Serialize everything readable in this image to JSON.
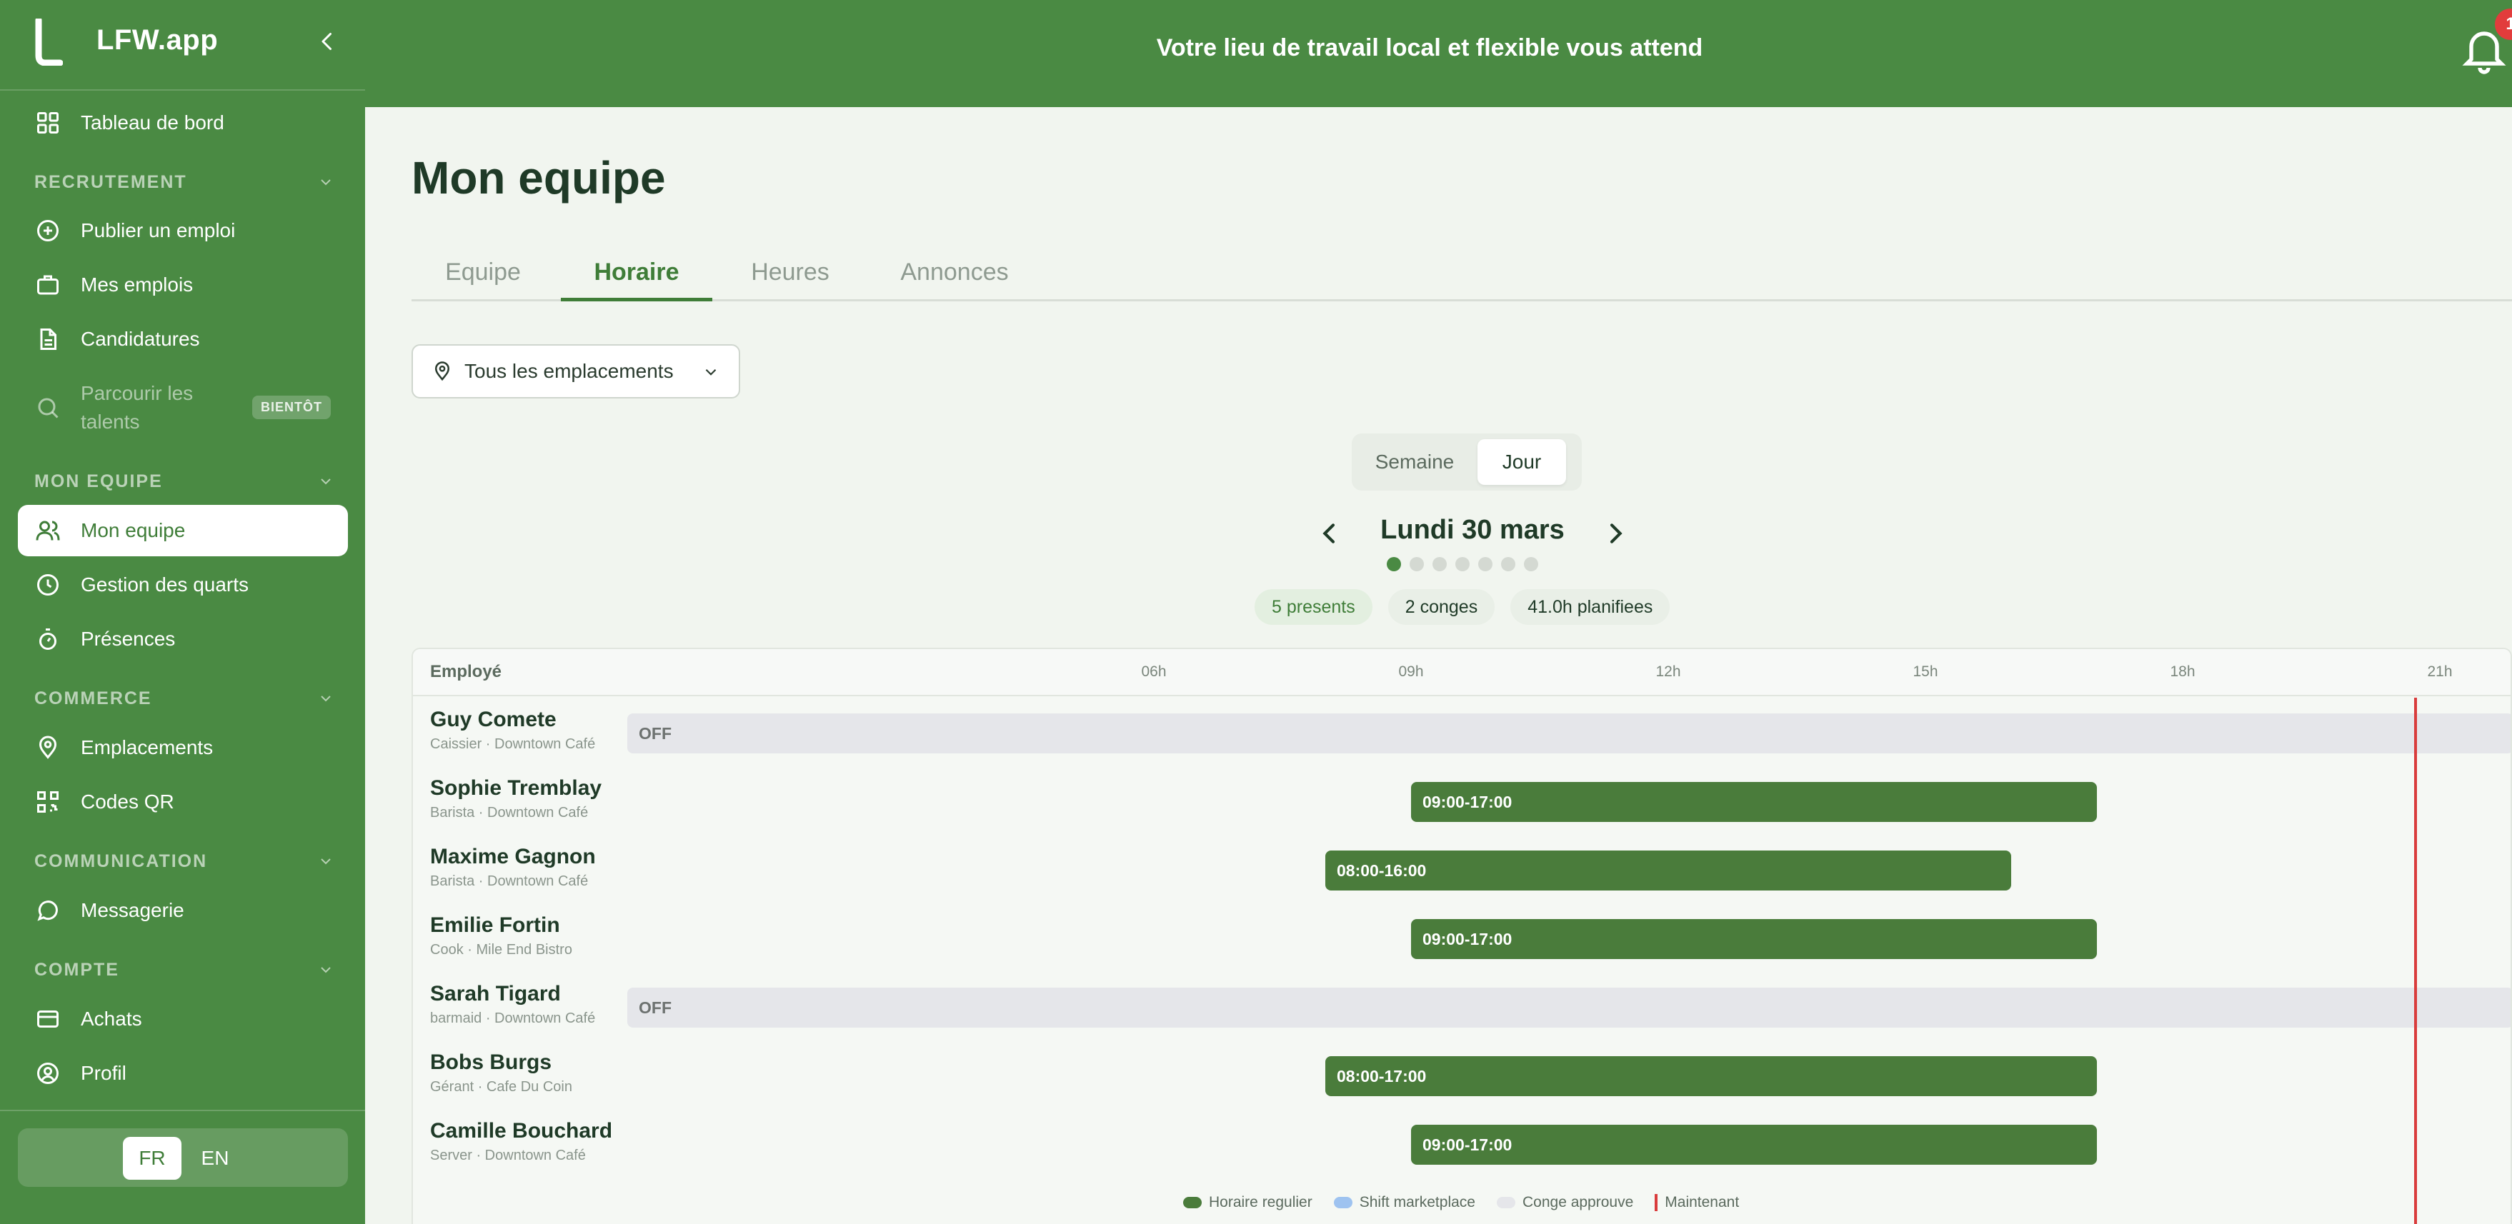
{
  "app": {
    "name": "LFW.app",
    "tagline": "Votre lieu de travail local et flexible vous attend",
    "notification_count": "1"
  },
  "colors": {
    "brand": "#4a8a43",
    "shift": "#4a7c3b",
    "now": "#d93c3c",
    "marketplace": "#9ec3f0",
    "leave": "#e5e6ea"
  },
  "sidebar": {
    "dashboard": "Tableau de bord",
    "sections": {
      "recruitment": "RECRUTEMENT",
      "team": "MON EQUIPE",
      "commerce": "COMMERCE",
      "communication": "COMMUNICATION",
      "account": "COMPTE"
    },
    "items": {
      "post_job": "Publier un emploi",
      "my_jobs": "Mes emplois",
      "applications": "Candidatures",
      "browse_talents": "Parcourir les talents",
      "soon_badge": "BIENTÔT",
      "my_team": "Mon equipe",
      "shift_mgmt": "Gestion des quarts",
      "attendance": "Présences",
      "locations": "Emplacements",
      "qr_codes": "Codes QR",
      "messaging": "Messagerie",
      "purchases": "Achats",
      "profile": "Profil"
    },
    "languages": [
      "FR",
      "EN"
    ],
    "active_language": "FR"
  },
  "page": {
    "title": "Mon equipe",
    "tabs": [
      "Equipe",
      "Horaire",
      "Heures",
      "Annonces"
    ],
    "active_tab": "Horaire",
    "location_filter": "Tous les emplacements",
    "view_toggle": [
      "Semaine",
      "Jour"
    ],
    "active_view": "Jour",
    "date": "Lundi 30 mars",
    "day_dots": 7,
    "active_dot": 0,
    "stats": {
      "present": "5 presents",
      "leave": "2 conges",
      "planned": "41.0h planifiees"
    }
  },
  "schedule": {
    "employee_header": "Employé",
    "hours": [
      "06h",
      "09h",
      "12h",
      "15h",
      "18h",
      "21h"
    ],
    "now_hour": 20.7,
    "rows": [
      {
        "name": "Guy Comete",
        "sub": "Caissier · Downtown Café",
        "type": "off",
        "label": "OFF"
      },
      {
        "name": "Sophie Tremblay",
        "sub": "Barista · Downtown Café",
        "type": "shift",
        "start": 9,
        "end": 17,
        "label": "09:00-17:00"
      },
      {
        "name": "Maxime Gagnon",
        "sub": "Barista · Downtown Café",
        "type": "shift",
        "start": 8,
        "end": 16,
        "label": "08:00-16:00"
      },
      {
        "name": "Emilie Fortin",
        "sub": "Cook · Mile End Bistro",
        "type": "shift",
        "start": 9,
        "end": 17,
        "label": "09:00-17:00"
      },
      {
        "name": "Sarah Tigard",
        "sub": "barmaid · Downtown Café",
        "type": "off",
        "label": "OFF"
      },
      {
        "name": "Bobs Burgs",
        "sub": "Gérant · Cafe Du Coin",
        "type": "shift",
        "start": 8,
        "end": 17,
        "label": "08:00-17:00"
      },
      {
        "name": "Camille Bouchard",
        "sub": "Server · Downtown Café",
        "type": "shift",
        "start": 9,
        "end": 17,
        "label": "09:00-17:00"
      }
    ]
  },
  "legend": {
    "regular": "Horaire regulier",
    "marketplace": "Shift marketplace",
    "leave": "Conge approuve",
    "now": "Maintenant"
  }
}
